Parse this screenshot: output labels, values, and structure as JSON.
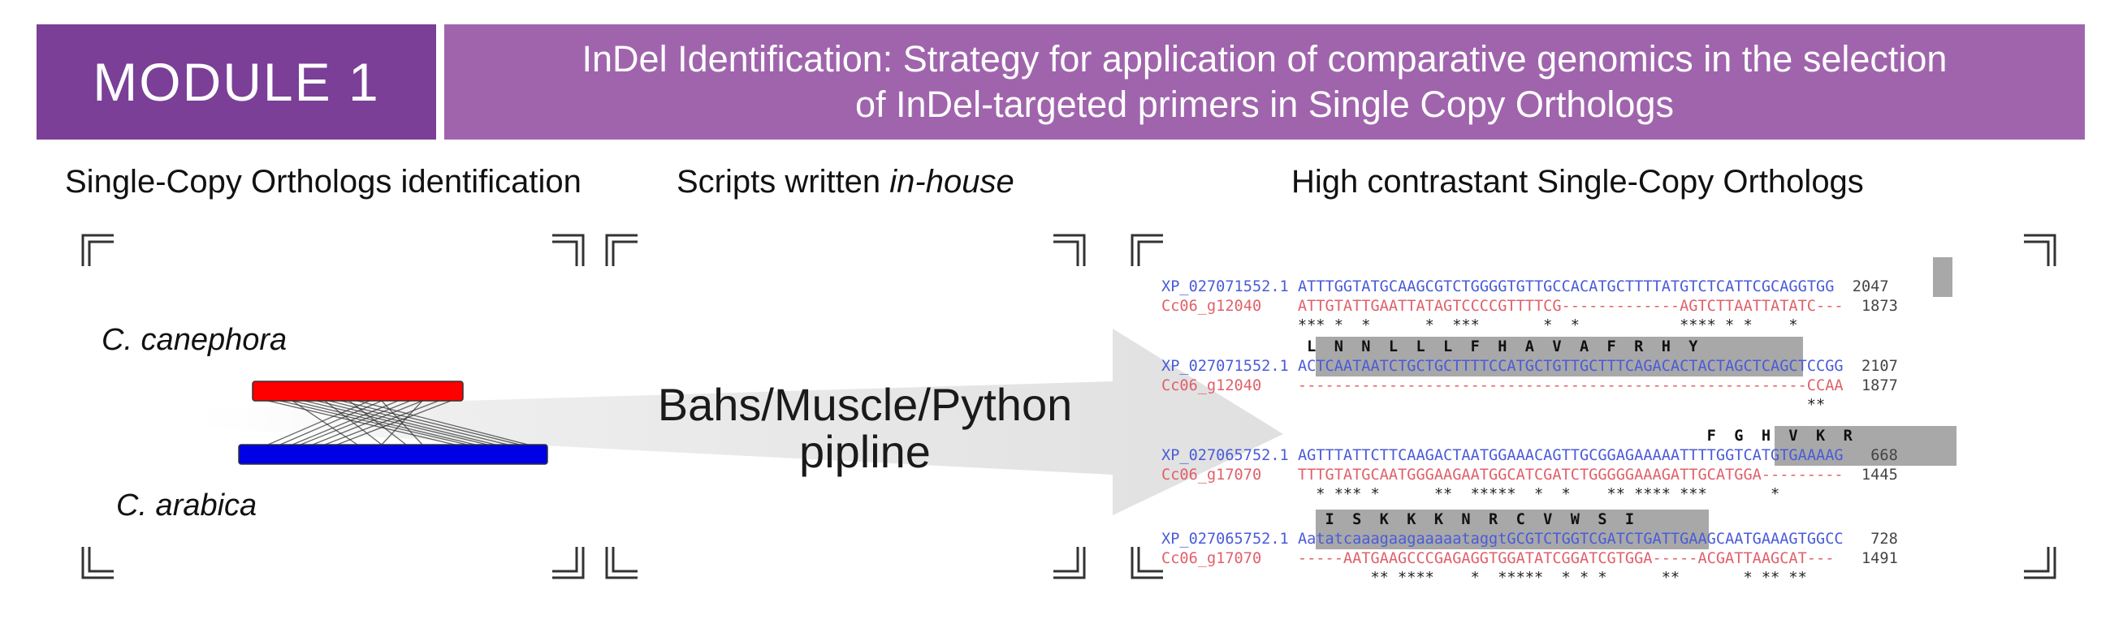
{
  "banner": {
    "module_label": "MODULE 1",
    "title_line1": "InDel Identification: Strategy for application of comparative genomics in the selection",
    "title_line2": "of InDel-targeted primers in Single  Copy Orthologs"
  },
  "sections": {
    "left_heading": "Single-Copy Orthologs identification",
    "middle_heading_prefix": "Scripts written ",
    "middle_heading_italic": "in-house",
    "right_heading": "High contrastant Single-Copy Orthologs"
  },
  "synteny": {
    "species_top": "C. canephora",
    "species_bottom": "C. arabica",
    "colors": {
      "top_bar": "#ff0000",
      "bottom_bar": "#0000e6",
      "links": "#333333"
    }
  },
  "pipeline": {
    "line1": "Bahs/Muscle/Python",
    "line2": "pipline"
  },
  "alignment": {
    "blocks": [
      {
        "aa": "",
        "id1": "XP_027071552.1",
        "seq1": "ATTTGGTATGCAAGCGTCTGGGGTGTTGCCACATGCTTTTATGTCTCATTCGCAGGTGG",
        "end1": "2047",
        "id2": "Cc06_g12040",
        "seq2": "ATTGTATTGAATTATAGTCCCCGTTTTCG-------------AGTCTTAATTATATC---",
        "end2": "1873",
        "stars": "*** *  *      *  ***       *  *           **** * *    *"
      },
      {
        "aa": " L  N  N  L  L  L  F  H  A  V  A  F  R  H  Y",
        "id1": "XP_027071552.1",
        "seq1": "ACTCAATAATCTGCTGCTTTTCCATGCTGTTGCTTTCAGACACTACTAGCTCAGCTCCGG",
        "end1": "2107",
        "id2": "Cc06_g12040",
        "seq2": "--------------------------------------------------------CCAA",
        "end2": "1877",
        "stars": "                                                        **"
      },
      {
        "aa": "                                             F  G  H  V  K  R",
        "id1": "XP_027065752.1",
        "seq1": "AGTTTATTCTTCAAGACTAATGGAAACAGTTGCGGAGAAAAATTTTGGTCATGTGAAAAG",
        "end1": "668",
        "id2": "Cc06_g17070",
        "seq2": "TTTGTATGCAATGGGAAGAATGGCATCGATCTGGGGGAAAGATTGCATGGA---------",
        "end2": "1445",
        "stars": "  * *** *      **  *****  *  *    ** **** ***       *"
      },
      {
        "aa": "   I  S  K  K  K  N  R  C  V  W  S  I",
        "id1": "XP_027065752.1",
        "seq1": "AatatcaaagaagaaaaataggtGCGTCTGGTCGATCTGATTGAAGCAATGAAAGTGGCC",
        "end1": "728",
        "id2": "Cc06_g17070",
        "seq2": "-----AATGAAGCCCGAGAGGTGGATATCGGATCGTGGA-----ACGATTAAGCAT---",
        "end2": "1491",
        "stars": "        ** ****    *  *****  * * *      **       * ** **"
      }
    ]
  }
}
